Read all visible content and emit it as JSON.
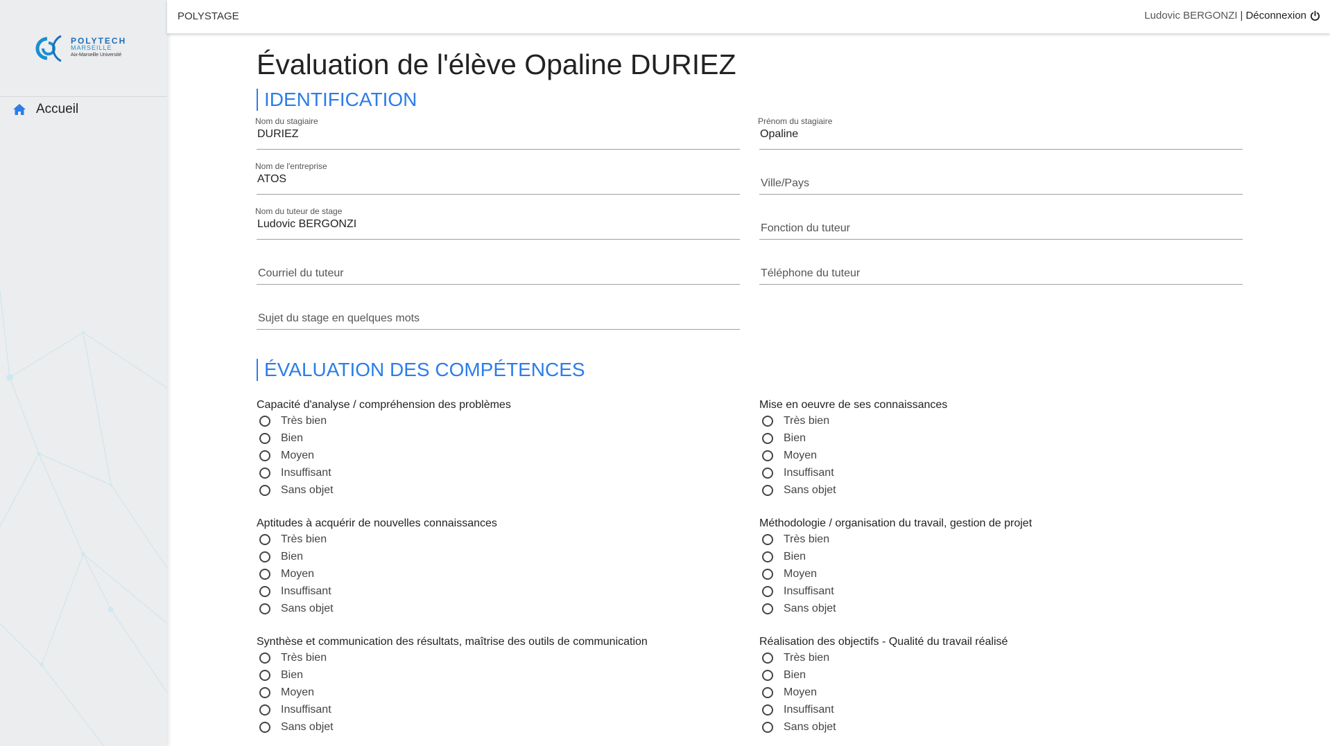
{
  "app": {
    "brand": "POLYSTAGE",
    "user_name": "Ludovic BERGONZI",
    "separator": "|",
    "logout_label": "Déconnexion"
  },
  "logo": {
    "main": "POLYTECH",
    "sub": "MARSEILLE",
    "university": "Aix-Marseille Université"
  },
  "sidebar": {
    "items": [
      {
        "label": "Accueil",
        "icon": "home-icon"
      }
    ]
  },
  "page": {
    "title": "Évaluation de l'élève Opaline DURIEZ"
  },
  "identification": {
    "title": "IDENTIFICATION",
    "fields": {
      "nom_stagiaire": {
        "label": "Nom du stagiaire",
        "value": "DURIEZ"
      },
      "prenom_stagiaire": {
        "label": "Prénom du stagiaire",
        "value": "Opaline"
      },
      "entreprise": {
        "label": "Nom de l'entreprise",
        "value": "ATOS"
      },
      "ville_pays": {
        "placeholder": "Ville/Pays"
      },
      "tuteur": {
        "label": "Nom du tuteur de stage",
        "value": "Ludovic BERGONZI"
      },
      "fonction_tuteur": {
        "placeholder": "Fonction du tuteur"
      },
      "courriel_tuteur": {
        "placeholder": "Courriel du tuteur"
      },
      "telephone_tuteur": {
        "placeholder": "Téléphone du tuteur"
      },
      "sujet": {
        "placeholder": "Sujet du stage en quelques mots"
      }
    }
  },
  "competences": {
    "title": "ÉVALUATION DES COMPÉTENCES",
    "options": [
      "Très bien",
      "Bien",
      "Moyen",
      "Insuffisant",
      "Sans objet"
    ],
    "groups": [
      {
        "title": "Capacité d'analyse / compréhension des problèmes"
      },
      {
        "title": "Mise en oeuvre de ses connaissances"
      },
      {
        "title": "Aptitudes à acquérir de nouvelles connaissances"
      },
      {
        "title": "Méthodologie / organisation du travail, gestion de projet"
      },
      {
        "title": "Synthèse et communication des résultats, maîtrise des outils de communication"
      },
      {
        "title": "Réalisation des objectifs - Qualité du travail réalisé"
      }
    ]
  },
  "colors": {
    "accent": "#2b7de9",
    "sidebar_bg": "#ecedef"
  }
}
